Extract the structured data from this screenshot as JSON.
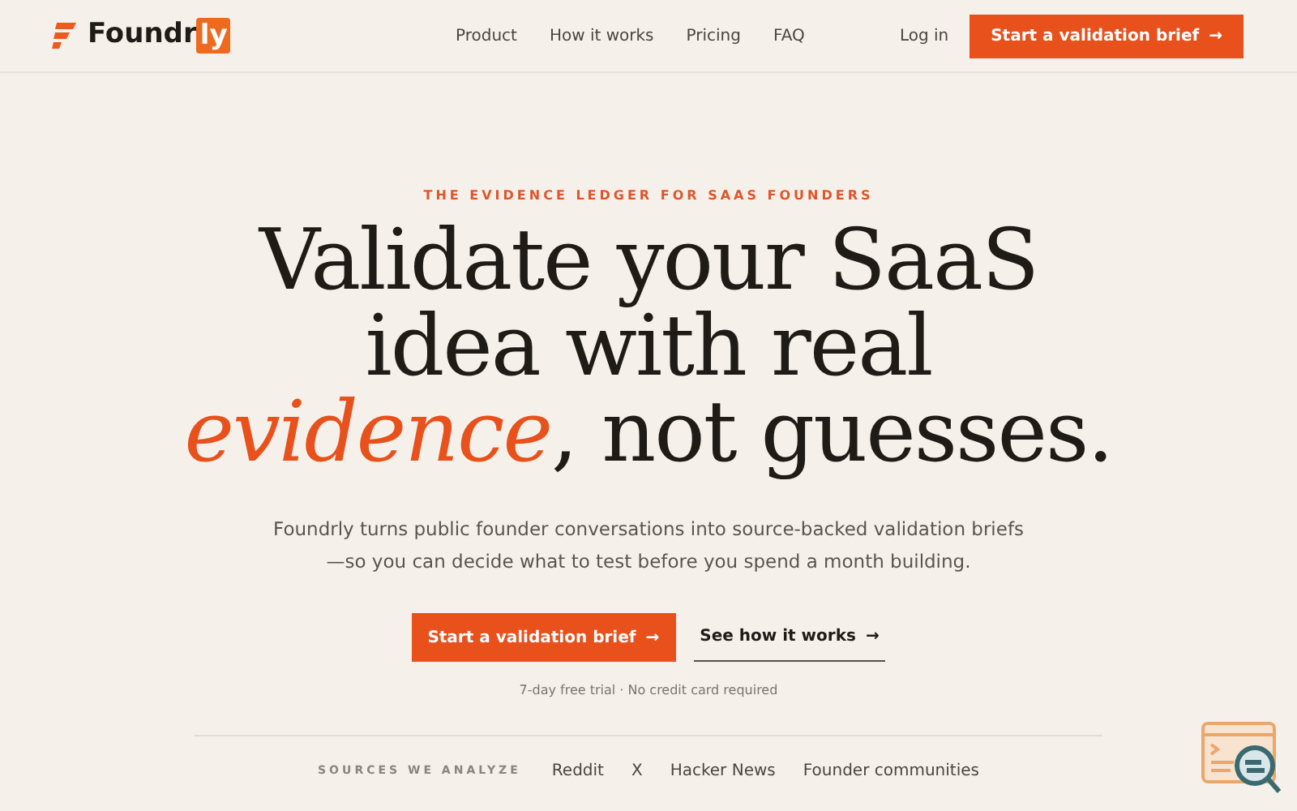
{
  "header": {
    "logo": {
      "text": "Foundr",
      "badge": "ly"
    },
    "nav": [
      "Product",
      "How it works",
      "Pricing",
      "FAQ"
    ],
    "login": "Log in",
    "cta": "Start a validation brief",
    "cta_arrow": "→"
  },
  "hero": {
    "eyebrow": "THE EVIDENCE LEDGER FOR SAAS FOUNDERS",
    "headline_lines": [
      "Validate your SaaS",
      "idea with real",
      "*evidence*, not guesses."
    ],
    "subtitle": "Foundrly turns public founder conversations into source-backed validation briefs—so you can decide what to test before you spend a month building.",
    "primary": {
      "label": "Start a validation brief",
      "arrow": "→"
    },
    "secondary": {
      "label": "See how it works",
      "arrow": "→"
    },
    "note": "7-day free trial · No credit card required"
  },
  "sources": {
    "label": "SOURCES WE ANALYZE",
    "items": [
      "Reddit",
      "X",
      "Hacker News",
      "Founder communities"
    ]
  }
}
